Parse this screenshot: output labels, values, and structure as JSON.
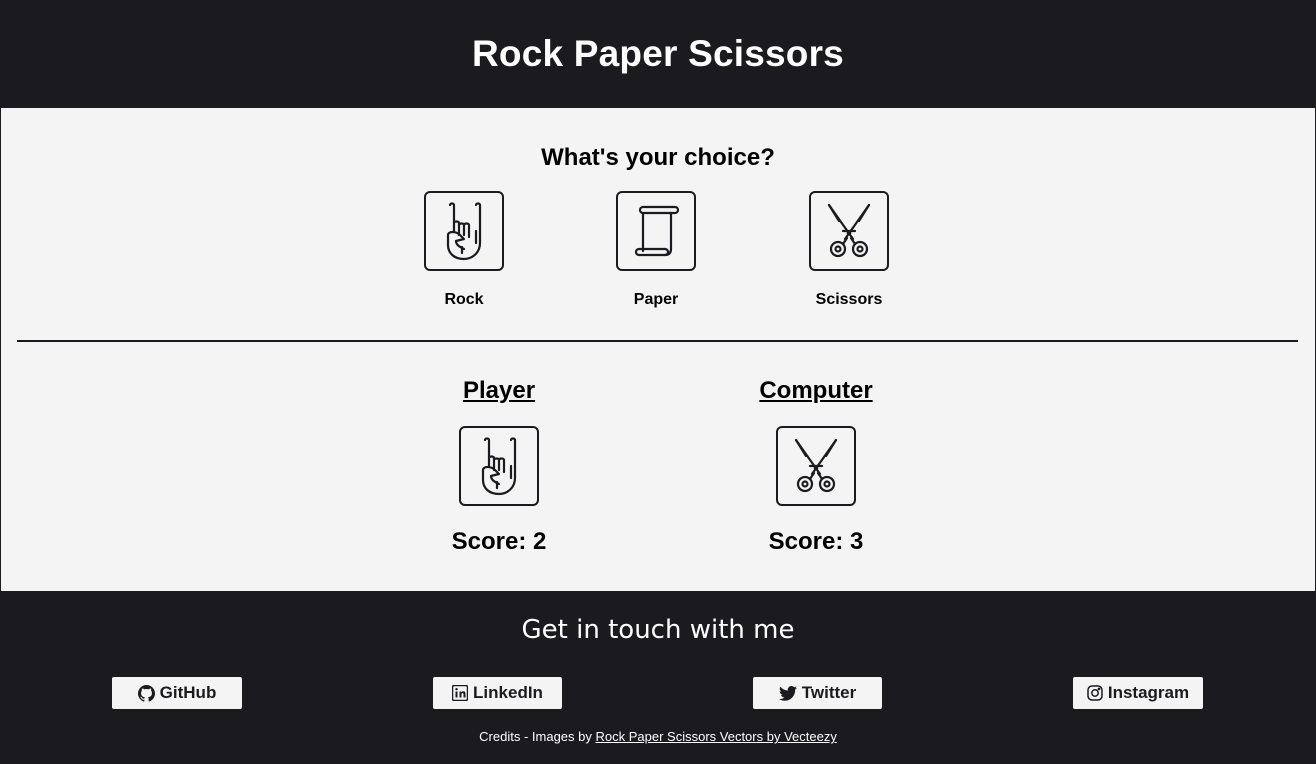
{
  "header": {
    "title": "Rock Paper Scissors"
  },
  "game": {
    "prompt": "What's your choice?",
    "choices": [
      {
        "label": "Rock",
        "icon": "rock-hand-icon"
      },
      {
        "label": "Paper",
        "icon": "paper-scroll-icon"
      },
      {
        "label": "Scissors",
        "icon": "scissors-icon"
      }
    ],
    "player": {
      "heading": "Player",
      "score_text": "Score: 2",
      "choice_icon": "rock-hand-icon"
    },
    "computer": {
      "heading": "Computer",
      "score_text": "Score: 3",
      "choice_icon": "scissors-icon"
    }
  },
  "footer": {
    "heading": "Get in touch with me",
    "links": [
      {
        "label": "GitHub",
        "icon": "github-icon"
      },
      {
        "label": "LinkedIn",
        "icon": "linkedin-icon"
      },
      {
        "label": "Twitter",
        "icon": "twitter-icon"
      },
      {
        "label": "Instagram",
        "icon": "instagram-icon"
      }
    ],
    "credits_prefix": "Credits - Images by",
    "credits_link": "Rock Paper Scissors Vectors by Vecteezy"
  },
  "colors": {
    "dark": "#1b1a1f",
    "light": "#f4f4f4"
  }
}
